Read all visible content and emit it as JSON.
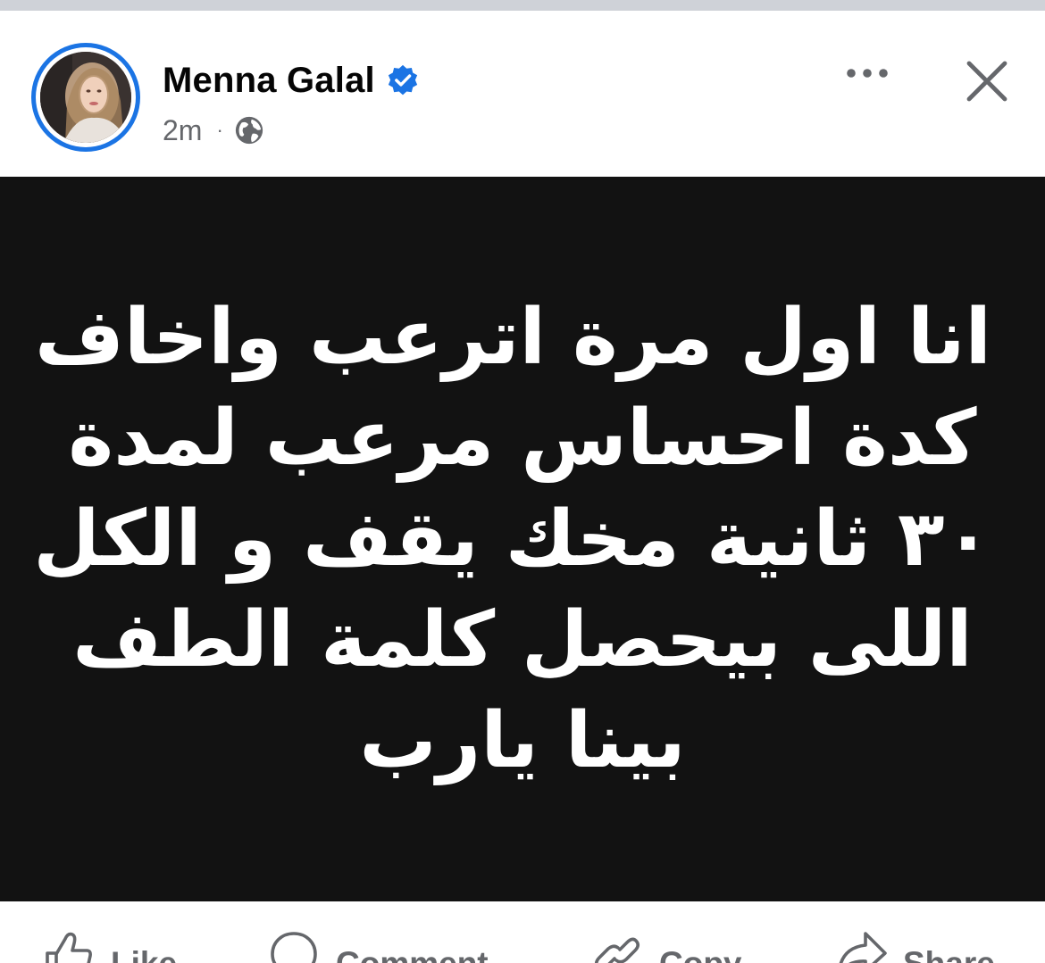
{
  "post": {
    "author": "Menna Galal",
    "time": "2m",
    "separator": "·",
    "privacy_icon": "globe-icon",
    "verified_icon": "verified-badge-icon",
    "colors": {
      "verified": "#1b74e4",
      "name": "#050505",
      "meta": "#65676b",
      "media_background": "#121212"
    }
  },
  "header_actions": {
    "more_icon": "more-horizontal-icon",
    "close_icon": "close-icon"
  },
  "media": {
    "lines": [
      "انا اول مرة اترعب واخاف",
      "كدة احساس مرعب لمدة",
      "٣٠ ثانية مخك يقف و الكل",
      "اللى بيحصل كلمة الطف",
      "بينا يارب"
    ]
  },
  "actions": {
    "like": "Like",
    "comment": "Comment",
    "copy": "Copy",
    "share": "Share"
  }
}
